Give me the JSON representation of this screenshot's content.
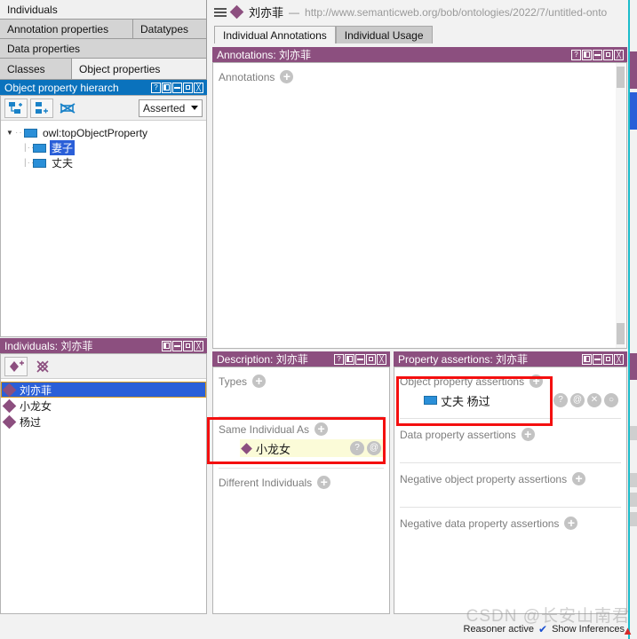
{
  "colors": {
    "purple": "#8c4f7f",
    "blue": "#0a72bd",
    "selection": "#2a5fd8",
    "highlight_box": "#f40f0f",
    "teal": "#1bbccb",
    "entry_highlight": "#fbfbd8"
  },
  "left": {
    "tab_rows": [
      [
        {
          "label": "Individuals",
          "selected": true
        }
      ],
      [
        {
          "label": "Annotation properties",
          "selected": false
        },
        {
          "label": "Datatypes",
          "selected": false
        }
      ],
      [
        {
          "label": "Data properties",
          "selected": false
        }
      ],
      [
        {
          "label": "Classes",
          "selected": false
        },
        {
          "label": "Object properties",
          "selected": true
        }
      ]
    ],
    "object_property_hierarchy": {
      "title": "Object property hierarch",
      "window_buttons": [
        "help",
        "columns",
        "minimize",
        "maximize",
        "close"
      ],
      "toolbar": {
        "add_sub_property_icon": "add-sub-property-icon",
        "add_sibling_property_icon": "add-sibling-property-icon",
        "delete_property_icon": "delete-property-icon",
        "reasoner_mode": "Asserted"
      },
      "tree": [
        {
          "label": "owl:topObjectProperty",
          "level": 0,
          "expanded": true,
          "selected": false
        },
        {
          "label": "妻子",
          "level": 1,
          "expanded": false,
          "selected": true
        },
        {
          "label": "丈夫",
          "level": 1,
          "expanded": false,
          "selected": false
        }
      ]
    },
    "individuals": {
      "title": "Individuals: 刘亦菲",
      "window_buttons": [
        "columns",
        "minimize",
        "maximize",
        "close"
      ],
      "toolbar": {
        "add_individual_icon": "add-individual-icon",
        "delete_individual_icon": "delete-individual-icon"
      },
      "items": [
        {
          "label": "刘亦菲",
          "selected": true
        },
        {
          "label": "小龙女",
          "selected": false
        },
        {
          "label": "杨过",
          "selected": false
        }
      ]
    }
  },
  "header": {
    "menu_icon": "hamburger-menu-icon",
    "entity_icon": "individual-diamond-icon",
    "entity_name": "刘亦菲",
    "separator": "—",
    "uri": "http://www.semanticweb.org/bob/ontologies/2022/7/untitled-onto"
  },
  "content_tabs": [
    {
      "label": "Individual Annotations",
      "selected": true
    },
    {
      "label": "Individual Usage",
      "selected": false
    }
  ],
  "annotations_panel": {
    "title": "Annotations: 刘亦菲",
    "window_buttons": [
      "help",
      "columns",
      "minimize",
      "maximize",
      "close"
    ],
    "section_label": "Annotations",
    "add_icon": "add-annotation-icon"
  },
  "description_panel": {
    "title": "Description: 刘亦菲",
    "window_buttons": [
      "help",
      "columns",
      "minimize",
      "maximize",
      "close"
    ],
    "sections": [
      {
        "label": "Types",
        "add_icon": "add-type-icon",
        "entries": [],
        "highlighted": false
      },
      {
        "label": "Same Individual As",
        "add_icon": "add-same-individual-icon",
        "highlighted": true,
        "entries": [
          {
            "icon": "individual-diamond-icon",
            "label": "小龙女",
            "actions": [
              "?",
              "@"
            ]
          }
        ]
      },
      {
        "label": "Different Individuals",
        "add_icon": "add-different-individuals-icon",
        "entries": [],
        "highlighted": false
      }
    ]
  },
  "property_assertions_panel": {
    "title": "Property assertions: 刘亦菲",
    "window_buttons": [
      "columns",
      "minimize",
      "maximize",
      "close"
    ],
    "sections": [
      {
        "label": "Object property assertions",
        "add_icon": "add-object-property-assertion-icon",
        "highlighted": true,
        "entries": [
          {
            "icon": "object-property-icon",
            "label": "丈夫 杨过",
            "actions": [
              "?",
              "@",
              "✕",
              "○"
            ]
          }
        ]
      },
      {
        "label": "Data property assertions",
        "add_icon": "add-data-property-assertion-icon",
        "entries": [],
        "highlighted": false
      },
      {
        "label": "Negative object property assertions",
        "add_icon": "add-negative-object-property-assertion-icon",
        "entries": [],
        "highlighted": false
      },
      {
        "label": "Negative data property assertions",
        "add_icon": "add-negative-data-property-assertion-icon",
        "entries": [],
        "highlighted": false
      }
    ]
  },
  "status_bar": {
    "reasoner_status": "Reasoner active",
    "show_inferences_label": "Show Inferences",
    "show_inferences_checked": true
  },
  "watermark": {
    "text": "CSDN @长安山南君",
    "icon": "csdn-logo-icon"
  }
}
